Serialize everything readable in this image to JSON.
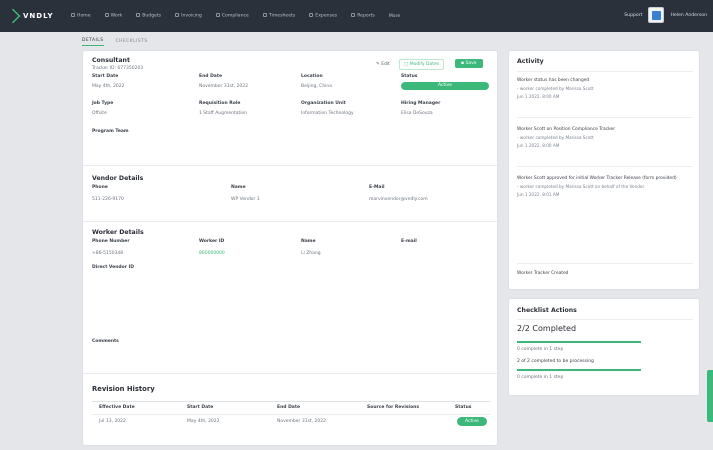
{
  "app": {
    "brand": "VNDLY"
  },
  "nav": {
    "items": [
      "Home",
      "Work",
      "Budgets",
      "Invoicing",
      "Compliance",
      "Timesheets",
      "Expenses",
      "Reports",
      "More"
    ]
  },
  "topright": {
    "help": "Support",
    "user": "Helen Anderson"
  },
  "tabs": [
    "DETAILS",
    "CHECKLISTS"
  ],
  "record": {
    "title": "Consultant",
    "tracker": "Tracker ID: 677350203",
    "actions": {
      "edit": "Edit",
      "modify": "Modify Dates",
      "save": "Save"
    },
    "fields": [
      {
        "label": "Start Date",
        "value": "May 4th, 2022"
      },
      {
        "label": "End Date",
        "value": "November 31st, 2022"
      },
      {
        "label": "Location",
        "value": "Beijing, China"
      },
      {
        "label": "Status",
        "value": "Active"
      },
      {
        "label": "Job Type",
        "value": "Offsite"
      },
      {
        "label": "Requisition Role",
        "value": "1 Staff Augmentation"
      },
      {
        "label": "Organization Unit",
        "value": "Information Technology"
      },
      {
        "label": "Hiring Manager",
        "value": "Elisa DeSouza"
      },
      {
        "label": "Program Team",
        "value": ""
      }
    ]
  },
  "vendor": {
    "title": "Vendor Details",
    "fields": [
      {
        "label": "Phone",
        "value": "511-226-9170"
      },
      {
        "label": "Name",
        "value": "WP Vendor 1"
      },
      {
        "label": "E-Mail",
        "value": "marvinvendor@vndly.com"
      }
    ]
  },
  "worker": {
    "title": "Worker Details",
    "fields": [
      {
        "label": "Phone Number",
        "value": "+86-5150348"
      },
      {
        "label": "Worker ID",
        "value": "860000000"
      },
      {
        "label": "Name",
        "value": "Li Zhang"
      },
      {
        "label": "E-mail",
        "value": ""
      }
    ],
    "direct_vendor_label": "Direct Vendor ID",
    "comments_label": "Comments"
  },
  "revision": {
    "title": "Revision History",
    "headers": [
      "Effective Date",
      "Start Date",
      "End Date",
      "Source for Revisions",
      "Status"
    ],
    "rows": [
      {
        "effective": "Jul 13, 2022",
        "start": "May 4th, 2022",
        "end": "November 31st, 2022",
        "source": "",
        "status": "Active"
      }
    ]
  },
  "activity": {
    "title": "Activity",
    "items": [
      {
        "title": "Worker status has been changed",
        "sub": "- worker completed by Marissa Scott",
        "time": "Jun 1 2022, 8:00 AM"
      },
      {
        "title": "Worker Scott on Position Compliance Tracker",
        "sub": "- worker completed by Marissa Scott",
        "time": "Jun 1 2022, 8:00 AM"
      },
      {
        "title": "Worker Scott approved for initial Worker Tracker Release (form provided)",
        "sub": "- worker completed by Marissa Scott on behalf of the Vendor",
        "time": "Jun 1 2022, 8:01 AM"
      },
      {
        "title": "Worker Tracker Created",
        "sub": "",
        "time": ""
      }
    ]
  },
  "checklist": {
    "title": "Checklist Actions",
    "summary": "2/2 Completed",
    "items": [
      "0 complete in 1 step",
      "2 of 2 completed to be processing",
      "0 complete in 1 step"
    ]
  },
  "colors": {
    "accent": "#3cb97a",
    "topbar": "#2b313a"
  }
}
